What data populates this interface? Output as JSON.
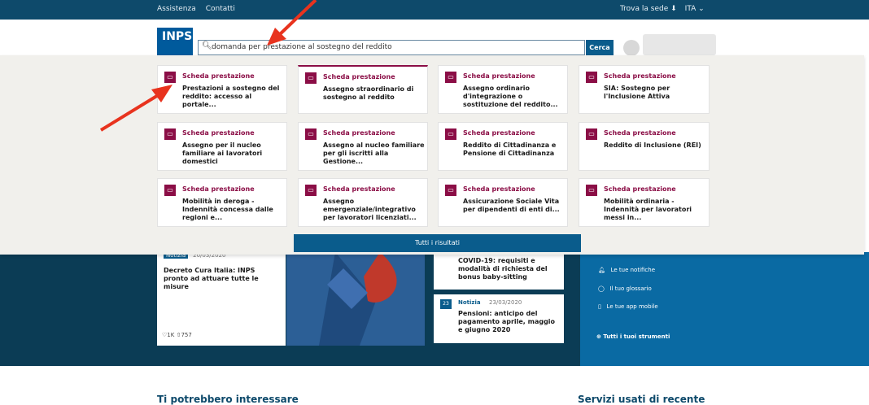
{
  "topbar": {
    "links": [
      "Assistenza",
      "Contatti"
    ],
    "right_sede": "Trova la sede",
    "right_lang": "ITA"
  },
  "header": {
    "logo": "INPS",
    "search_value": "domanda per prestazione al sostegno del reddito",
    "search_button": "Cerca"
  },
  "overlay": {
    "cards": [
      {
        "kind": "Scheda prestazione",
        "title": "Prestazioni a sostegno del reddito: accesso al portale..."
      },
      {
        "kind": "Scheda prestazione",
        "title": "Assegno straordinario di sostegno al reddito"
      },
      {
        "kind": "Scheda prestazione",
        "title": "Assegno ordinario d'integrazione o sostituzione del reddito..."
      },
      {
        "kind": "Scheda prestazione",
        "title": "SIA: Sostegno per l'Inclusione Attiva"
      },
      {
        "kind": "Scheda prestazione",
        "title": "Assegno per il nucleo familiare ai lavoratori domestici"
      },
      {
        "kind": "Scheda prestazione",
        "title": "Assegno al nucleo familiare per gli iscritti alla Gestione..."
      },
      {
        "kind": "Scheda prestazione",
        "title": "Reddito di Cittadinanza e Pensione di Cittadinanza"
      },
      {
        "kind": "Scheda prestazione",
        "title": "Reddito di Inclusione (REI)"
      },
      {
        "kind": "Scheda prestazione",
        "title": "Mobilità in deroga - Indennità concessa dalle regioni e..."
      },
      {
        "kind": "Scheda prestazione",
        "title": "Assegno emergenziale/integrativo per lavoratori licenziati..."
      },
      {
        "kind": "Scheda prestazione",
        "title": "Assicurazione Sociale Vita per dipendenti di enti di..."
      },
      {
        "kind": "Scheda prestazione",
        "title": "Mobilità ordinaria - Indennità per lavoratori messi in..."
      }
    ],
    "all_results": "Tutti i risultati"
  },
  "news": {
    "n1_tag": "Notizia",
    "n1_date": "20/03/2020",
    "n1_title": "Decreto Cura Italia: INPS pronto ad attuare tutte le misure",
    "n1_likes": "1K",
    "n1_shares": "757",
    "n2_title": "COVID-19: requisiti e modalità di richiesta del bonus baby-sitting",
    "n3_tag": "Notizia",
    "n3_date": "23/03/2020",
    "n3_title": "Pensioni: anticipo del pagamento aprile, maggio e giugno 2020"
  },
  "sidebar": {
    "items": [
      "Le tue notifiche",
      "Il tuo glossario",
      "Le tue app mobile"
    ],
    "all_tools": "Tutti i tuoi strumenti"
  },
  "bottom": {
    "left_heading": "Ti potrebbero interessare",
    "right_heading": "Servizi usati di recente"
  }
}
